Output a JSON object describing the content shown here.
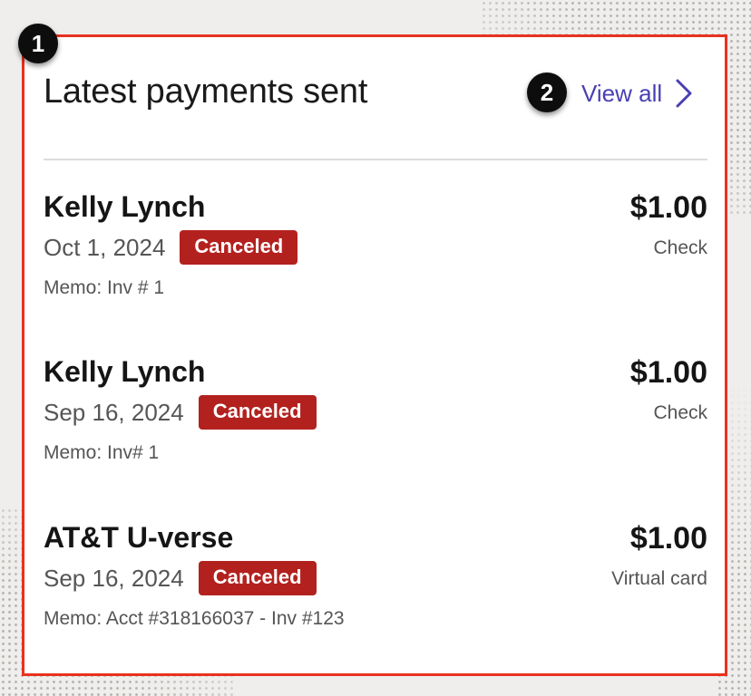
{
  "markers": [
    "1",
    "2"
  ],
  "header": {
    "title": "Latest payments sent",
    "view_all_label": "View all"
  },
  "payments": [
    {
      "name": "Kelly Lynch",
      "amount": "$1.00",
      "date": "Oct 1, 2024",
      "status": "Canceled",
      "method": "Check",
      "memo": "Memo: Inv # 1"
    },
    {
      "name": "Kelly Lynch",
      "amount": "$1.00",
      "date": "Sep 16, 2024",
      "status": "Canceled",
      "method": "Check",
      "memo": "Memo: Inv# 1"
    },
    {
      "name": "AT&T U-verse",
      "amount": "$1.00",
      "date": "Sep 16, 2024",
      "status": "Canceled",
      "method": "Virtual card",
      "memo": "Memo: Acct #318166037 - Inv #123"
    }
  ],
  "icons": {
    "view_all": "chevron-right-icon"
  },
  "colors": {
    "highlight_border": "#e8321f",
    "link": "#4a3fb3",
    "status_canceled": "#b3211e",
    "marker": "#0d0d0d"
  }
}
